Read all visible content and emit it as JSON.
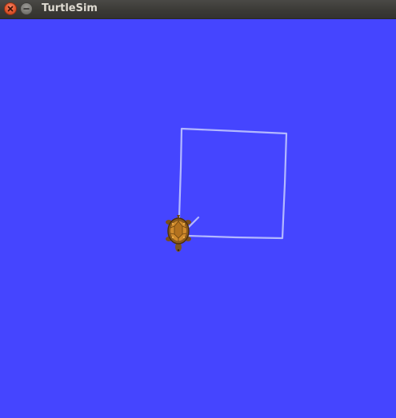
{
  "window": {
    "title": "TurtleSim",
    "close_icon": "close-icon",
    "minimize_icon": "minimize-icon"
  },
  "canvas": {
    "background_color": "#4545ff",
    "pen_color": "#b3b8ff",
    "turtle_icon": "turtle-icon"
  }
}
